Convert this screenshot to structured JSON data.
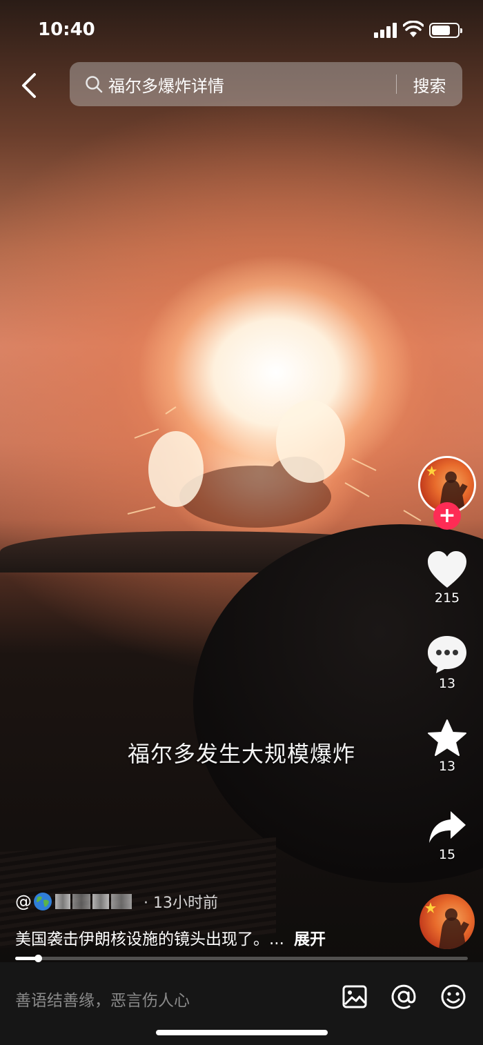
{
  "status_bar": {
    "time": "10:40"
  },
  "search": {
    "query": "福尔多爆炸详情",
    "button_label": "搜索"
  },
  "video": {
    "caption": "福尔多发生大规模爆炸",
    "progress_fraction": 0.05
  },
  "actions": {
    "likes": "215",
    "comments": "13",
    "favorites": "13",
    "shares": "15",
    "follow_label": "+"
  },
  "post": {
    "at_sign": "@",
    "time_ago": "· 13小时前",
    "description": "美国袭击伊朗核设施的镜头出现了。...",
    "expand_label": "展开"
  },
  "comment_bar": {
    "placeholder": "善语结善缘，恶言伤人心"
  },
  "icons": [
    "back-icon",
    "search-icon",
    "heart-icon",
    "comment-icon",
    "star-icon",
    "share-icon",
    "image-icon",
    "mention-icon",
    "emoji-icon",
    "globe-icon"
  ]
}
